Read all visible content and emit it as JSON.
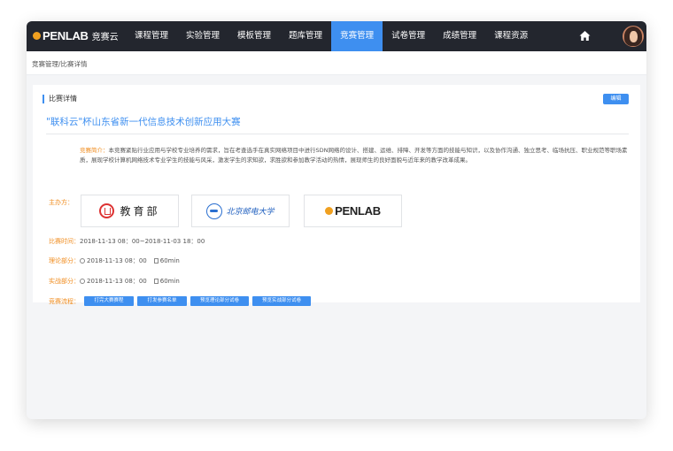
{
  "header": {
    "logo_text": "PENLAB",
    "logo_suffix": "竞赛云",
    "nav": [
      {
        "label": "课程管理"
      },
      {
        "label": "实验管理"
      },
      {
        "label": "模板管理"
      },
      {
        "label": "题库管理"
      },
      {
        "label": "竞赛管理",
        "active": true
      },
      {
        "label": "试卷管理"
      },
      {
        "label": "成绩管理"
      },
      {
        "label": "课程资源"
      }
    ],
    "home_icon": "home-icon",
    "avatar_icon": "user-avatar"
  },
  "breadcrumb": "竞赛管理/比赛详情",
  "panel": {
    "heading": "比赛详情",
    "edit_label": "编辑",
    "contest_title": "\"联科云\"杯山东省新一代信息技术创新应用大赛",
    "intro_label": "竞赛简介：",
    "intro_text": "本竞赛紧贴行业应用与学校专业培养的需求，旨在考查选手在真实网络项目中进行SDN网络的设计、搭建、运维、排障、开发等方面的技能与知识，以及协作沟通、独立思考、临场抗压、职业规范等职场素质，展现学校计算机网络技术专业学生的技能与风采，激发学生的求知欲，求胜欲和参加教学活动的热情，展现师生的良好面貌与近年来的教学改革成果。",
    "organizer_label": "主办方：",
    "organizers": [
      {
        "name": "教育部",
        "icon": "moe-emblem-icon"
      },
      {
        "name": "北京邮电大学",
        "icon": "bupt-emblem-icon"
      },
      {
        "name": "PENLAB",
        "icon": "penlab-logo-icon"
      }
    ],
    "time_label": "比赛时间：",
    "time_value": "2018-11-13 08：00~2018-11-03 18：00",
    "theory_label": "理论部分：",
    "theory_time": "2018-11-13 08：00",
    "theory_duration": "60min",
    "practice_label": "实战部分：",
    "practice_time": "2018-11-13 08：00",
    "practice_duration": "60min",
    "process_label": "竞赛流程：",
    "process_buttons": [
      "打完大赛赛程",
      "打发参赛名单",
      "预览理论部分试卷",
      "预览实战部分试卷"
    ]
  },
  "colors": {
    "topbar": "#23262e",
    "accent": "#3e8ff0",
    "label": "#f08c1e"
  }
}
